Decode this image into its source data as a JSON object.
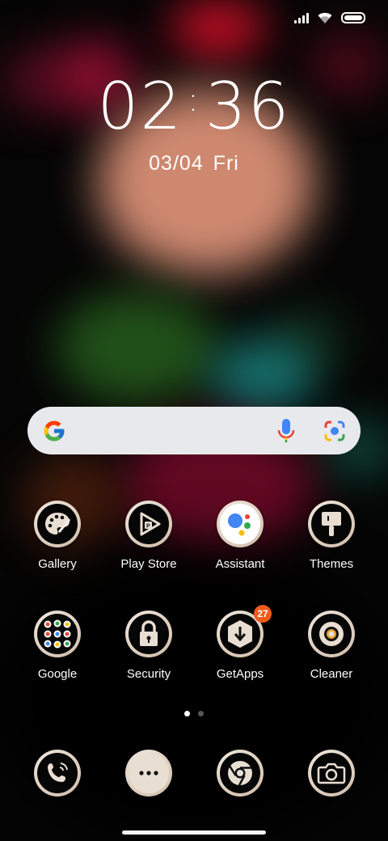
{
  "status_bar": {
    "signal_icon": "signal-icon",
    "wifi_icon": "wifi-icon",
    "battery_icon": "battery-icon"
  },
  "clock": {
    "time": "02:36",
    "hours": "02",
    "minutes": "36",
    "date": "03/04",
    "weekday": "Fri"
  },
  "search_bar": {
    "logo": "G",
    "mic_icon": "mic-icon",
    "lens_icon": "lens-icon"
  },
  "apps": [
    {
      "label": "Gallery",
      "icon": "palette-icon"
    },
    {
      "label": "Play Store",
      "icon": "play-store-icon"
    },
    {
      "label": "Assistant",
      "icon": "assistant-icon"
    },
    {
      "label": "Themes",
      "icon": "themes-brush-icon"
    },
    {
      "label": "Google",
      "icon": "google-folder-icon"
    },
    {
      "label": "Security",
      "icon": "lock-icon"
    },
    {
      "label": "GetApps",
      "icon": "download-icon",
      "badge": "27"
    },
    {
      "label": "Cleaner",
      "icon": "cleaner-icon"
    }
  ],
  "page_indicator": {
    "pages": 2,
    "current": 1
  },
  "dock": [
    {
      "icon": "phone-icon"
    },
    {
      "icon": "messages-icon"
    },
    {
      "icon": "chrome-icon"
    },
    {
      "icon": "camera-icon"
    }
  ],
  "colors": {
    "badge": "#f05a1a",
    "search_bg": "#e8e9ec"
  }
}
